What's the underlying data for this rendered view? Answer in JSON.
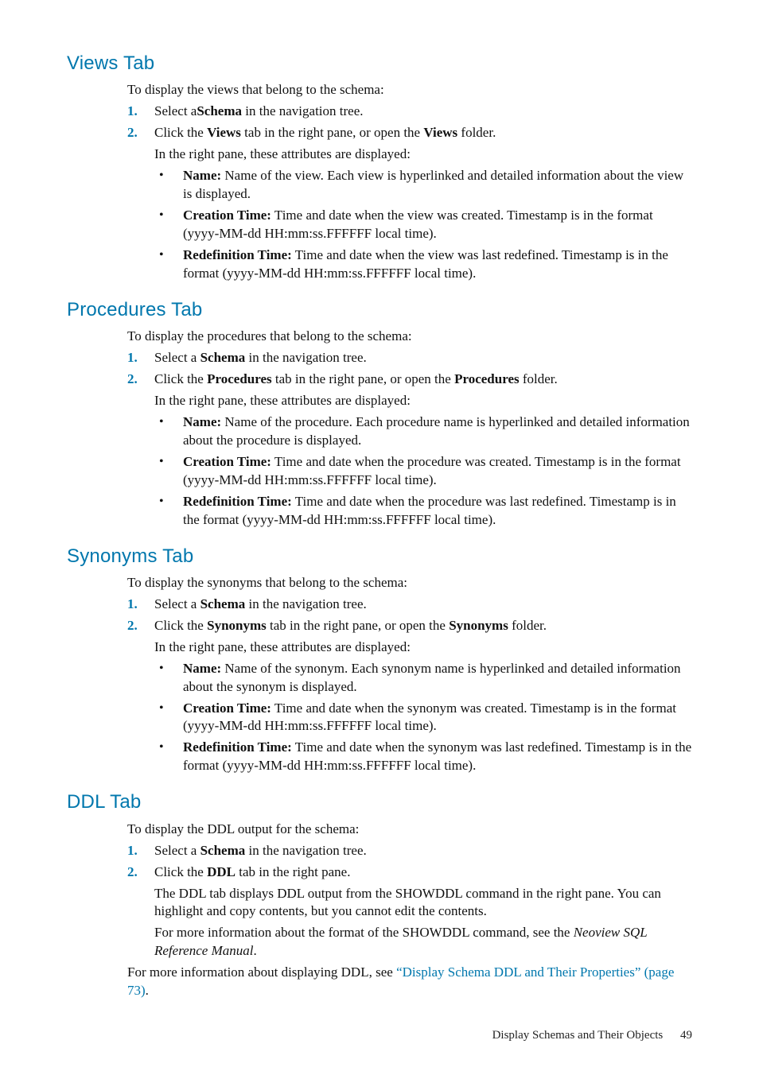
{
  "sections": {
    "views": {
      "heading": "Views Tab",
      "intro": "To display the views that belong to the schema:",
      "step1_pre": "Select a",
      "step1_b": "Schema",
      "step1_post": " in the navigation tree.",
      "step2_pre": "Click the ",
      "step2_b1": "Views",
      "step2_mid": " tab in the right pane, or open the ",
      "step2_b2": "Views",
      "step2_post": " folder.",
      "sub": "In the right pane, these attributes are displayed:",
      "bullets": {
        "b1_label": "Name:",
        "b1_text": " Name of the view. Each view is hyperlinked and detailed information about the view is displayed.",
        "b2_label": "Creation Time:",
        "b2_text": " Time and date when the view was created. Timestamp is in the format (yyyy-MM-dd HH:mm:ss.FFFFFF local time).",
        "b3_label": "Redefinition Time:",
        "b3_text": " Time and date when the view was last redefined. Timestamp is in the format (yyyy-MM-dd HH:mm:ss.FFFFFF local time)."
      }
    },
    "procedures": {
      "heading": "Procedures Tab",
      "intro": "To display the procedures that belong to the schema:",
      "step1_pre": "Select a ",
      "step1_b": "Schema",
      "step1_post": " in the navigation tree.",
      "step2_pre": "Click the ",
      "step2_b1": "Procedures",
      "step2_mid": " tab in the right pane, or open the ",
      "step2_b2": "Procedures",
      "step2_post": " folder.",
      "sub": "In the right pane, these attributes are displayed:",
      "bullets": {
        "b1_label": "Name:",
        "b1_text": " Name of the procedure. Each procedure name is hyperlinked and detailed information about the procedure is displayed.",
        "b2_label": "Creation Time:",
        "b2_text": " Time and date when the procedure was created. Timestamp is in the format (yyyy-MM-dd HH:mm:ss.FFFFFF local time).",
        "b3_label": "Redefinition Time:",
        "b3_text": " Time and date when the procedure was last redefined. Timestamp is in the format (yyyy-MM-dd HH:mm:ss.FFFFFF local time)."
      }
    },
    "synonyms": {
      "heading": "Synonyms Tab",
      "intro": "To display the synonyms that belong to the schema:",
      "step1_pre": "Select a ",
      "step1_b": "Schema",
      "step1_post": " in the navigation tree.",
      "step2_pre": "Click the ",
      "step2_b1": "Synonyms",
      "step2_mid": " tab in the right pane, or open the ",
      "step2_b2": "Synonyms",
      "step2_post": " folder.",
      "sub": "In the right pane, these attributes are displayed:",
      "bullets": {
        "b1_label": "Name:",
        "b1_text": " Name of the synonym. Each synonym name is hyperlinked and detailed information about the synonym is displayed.",
        "b2_label": "Creation Time:",
        "b2_text": " Time and date when the synonym was created. Timestamp is in the format (yyyy-MM-dd HH:mm:ss.FFFFFF local time).",
        "b3_label": "Redefinition Time:",
        "b3_text": " Time and date when the synonym was last redefined. Timestamp is in the format (yyyy-MM-dd HH:mm:ss.FFFFFF local time)."
      }
    },
    "ddl": {
      "heading": "DDL Tab",
      "intro": "To display the DDL output for the schema:",
      "step1_pre": "Select a ",
      "step1_b": "Schema",
      "step1_post": " in the navigation tree.",
      "step2_pre": "Click the ",
      "step2_b1": "DDL",
      "step2_post": " tab in the right pane.",
      "p1": "The DDL tab displays DDL output from the SHOWDDL command in the right pane. You can highlight and copy contents, but you cannot edit the contents.",
      "p2_pre": "For more information about the format of the SHOWDDL command, see the ",
      "p2_i": "Neoview SQL Reference Manual",
      "p2_post": ".",
      "closing_pre": "For more information about displaying DDL, see ",
      "closing_link": "“Display Schema DDL and Their Properties” (page 73)",
      "closing_post": "."
    }
  },
  "numbers": {
    "n1": "1.",
    "n2": "2."
  },
  "bullet_glyph": "•",
  "footer": {
    "title": "Display Schemas and Their Objects",
    "page": "49"
  }
}
